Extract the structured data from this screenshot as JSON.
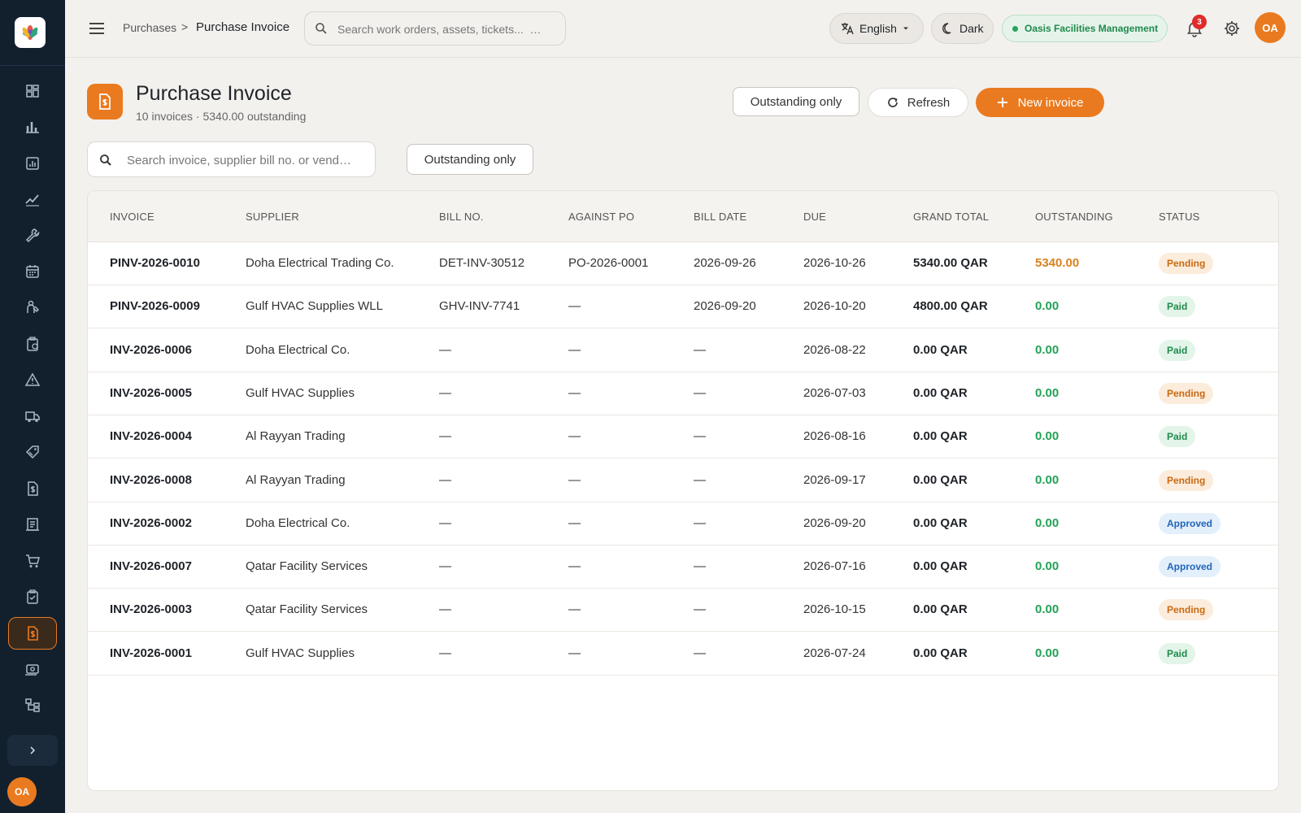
{
  "breadcrumb": {
    "parent": "Purchases",
    "separator": ">",
    "current": "Purchase Invoice"
  },
  "top_search": {
    "placeholder": "Search work orders, assets, tickets...  …"
  },
  "language": {
    "label": "English"
  },
  "theme_toggle": {
    "label": "Dark"
  },
  "organization": {
    "label": "Oasis Facilities Management"
  },
  "notifications": {
    "count": "3"
  },
  "user": {
    "initials": "OA"
  },
  "sidebar": {
    "items": [
      {
        "icon": "dashboard-icon"
      },
      {
        "icon": "bar-chart-icon"
      },
      {
        "icon": "report-icon"
      },
      {
        "icon": "trend-icon"
      },
      {
        "icon": "wrench-icon"
      },
      {
        "icon": "calendar-icon"
      },
      {
        "icon": "technician-icon"
      },
      {
        "icon": "clipboard-icon"
      },
      {
        "icon": "warning-icon"
      },
      {
        "icon": "truck-icon"
      },
      {
        "icon": "tag-icon"
      },
      {
        "icon": "invoice-icon"
      },
      {
        "icon": "ledger-icon"
      },
      {
        "icon": "cart-icon"
      },
      {
        "icon": "checklist-icon"
      },
      {
        "icon": "purchase-invoice-icon",
        "active": true
      },
      {
        "icon": "payment-icon"
      },
      {
        "icon": "hierarchy-icon"
      }
    ],
    "user_initials": "OA"
  },
  "header": {
    "title": "Purchase Invoice",
    "subtitle": "10 invoices · 5340.00 outstanding",
    "outstanding_button": "Outstanding only",
    "refresh_button": "Refresh",
    "new_button": "New invoice"
  },
  "filters": {
    "search_placeholder": "Search invoice, supplier bill no. or vend…",
    "outstanding_button": "Outstanding only"
  },
  "colors": {
    "accent": "#ea7a1f",
    "paid_bg": "#e3f4e9",
    "paid_text": "#1e8a4c",
    "pending_bg": "#fcecdc",
    "pending_text": "#c86a12",
    "approved_bg": "#e3effb",
    "approved_text": "#2266b8"
  },
  "table": {
    "columns": [
      "INVOICE",
      "SUPPLIER",
      "BILL NO.",
      "AGAINST PO",
      "BILL DATE",
      "DUE",
      "GRAND TOTAL",
      "OUTSTANDING",
      "STATUS"
    ],
    "rows": [
      {
        "invoice": "PINV-2026-0010",
        "supplier": "Doha Electrical Trading Co.",
        "bill_no": "DET-INV-30512",
        "against_po": "PO-2026-0001",
        "bill_date": "2026-09-26",
        "due": "2026-10-26",
        "grand_total": "5340.00 QAR",
        "outstanding": "5340.00",
        "outstanding_state": "due",
        "status": "Pending"
      },
      {
        "invoice": "PINV-2026-0009",
        "supplier": "Gulf HVAC Supplies WLL",
        "bill_no": "GHV-INV-7741",
        "against_po": "—",
        "bill_date": "2026-09-20",
        "due": "2026-10-20",
        "grand_total": "4800.00 QAR",
        "outstanding": "0.00",
        "outstanding_state": "clear",
        "status": "Paid"
      },
      {
        "invoice": "INV-2026-0006",
        "supplier": "Doha Electrical Co.",
        "bill_no": "—",
        "against_po": "—",
        "bill_date": "—",
        "due": "2026-08-22",
        "grand_total": "0.00 QAR",
        "outstanding": "0.00",
        "outstanding_state": "clear",
        "status": "Paid"
      },
      {
        "invoice": "INV-2026-0005",
        "supplier": "Gulf HVAC Supplies",
        "bill_no": "—",
        "against_po": "—",
        "bill_date": "—",
        "due": "2026-07-03",
        "grand_total": "0.00 QAR",
        "outstanding": "0.00",
        "outstanding_state": "clear",
        "status": "Pending"
      },
      {
        "invoice": "INV-2026-0004",
        "supplier": "Al Rayyan Trading",
        "bill_no": "—",
        "against_po": "—",
        "bill_date": "—",
        "due": "2026-08-16",
        "grand_total": "0.00 QAR",
        "outstanding": "0.00",
        "outstanding_state": "clear",
        "status": "Paid"
      },
      {
        "invoice": "INV-2026-0008",
        "supplier": "Al Rayyan Trading",
        "bill_no": "—",
        "against_po": "—",
        "bill_date": "—",
        "due": "2026-09-17",
        "grand_total": "0.00 QAR",
        "outstanding": "0.00",
        "outstanding_state": "clear",
        "status": "Pending"
      },
      {
        "invoice": "INV-2026-0002",
        "supplier": "Doha Electrical Co.",
        "bill_no": "—",
        "against_po": "—",
        "bill_date": "—",
        "due": "2026-09-20",
        "grand_total": "0.00 QAR",
        "outstanding": "0.00",
        "outstanding_state": "clear",
        "status": "Approved"
      },
      {
        "invoice": "INV-2026-0007",
        "supplier": "Qatar Facility Services",
        "bill_no": "—",
        "against_po": "—",
        "bill_date": "—",
        "due": "2026-07-16",
        "grand_total": "0.00 QAR",
        "outstanding": "0.00",
        "outstanding_state": "clear",
        "status": "Approved"
      },
      {
        "invoice": "INV-2026-0003",
        "supplier": "Qatar Facility Services",
        "bill_no": "—",
        "against_po": "—",
        "bill_date": "—",
        "due": "2026-10-15",
        "grand_total": "0.00 QAR",
        "outstanding": "0.00",
        "outstanding_state": "clear",
        "status": "Pending"
      },
      {
        "invoice": "INV-2026-0001",
        "supplier": "Gulf HVAC Supplies",
        "bill_no": "—",
        "against_po": "—",
        "bill_date": "—",
        "due": "2026-07-24",
        "grand_total": "0.00 QAR",
        "outstanding": "0.00",
        "outstanding_state": "clear",
        "status": "Paid"
      }
    ]
  }
}
